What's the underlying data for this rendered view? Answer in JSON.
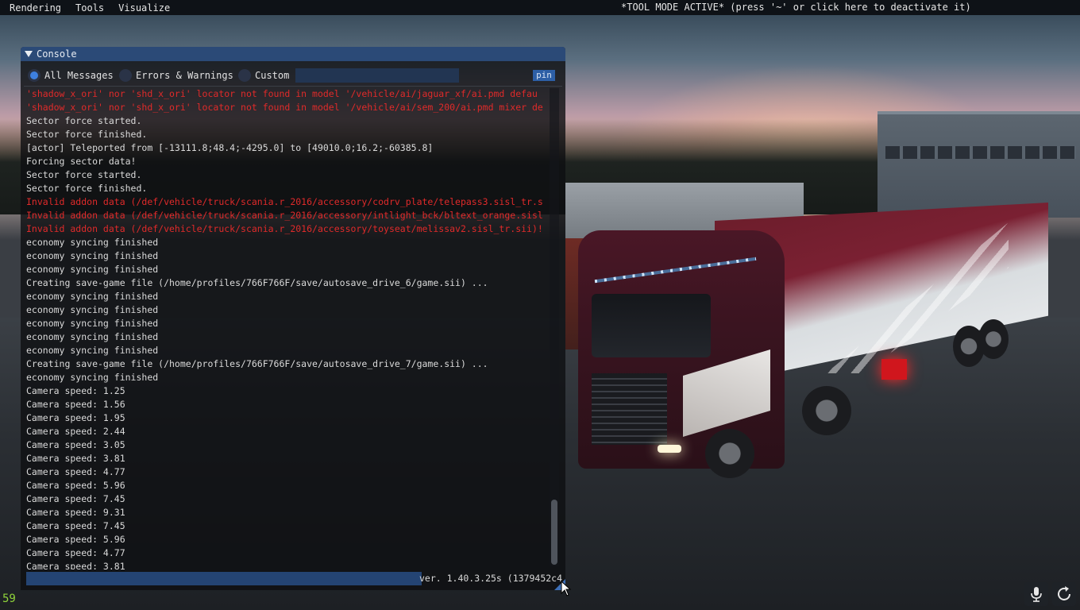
{
  "menubar": {
    "items": [
      "Rendering",
      "Tools",
      "Visualize"
    ],
    "tool_mode_notice": "*TOOL MODE ACTIVE* (press '~' or click here to deactivate it)"
  },
  "console": {
    "title": "Console",
    "filters": {
      "all_messages": "All Messages",
      "errors_warnings": "Errors & Warnings",
      "custom": "Custom",
      "selected": "All Messages",
      "custom_filter_value": ""
    },
    "pin_label": "pin",
    "log": [
      {
        "text": "'shadow_x_ori' nor 'shd_x_ori' locator not found in model '/vehicle/ai/jaguar_xf/ai.pmd defau",
        "type": "error"
      },
      {
        "text": "'shadow_x_ori' nor 'shd_x_ori' locator not found in model '/vehicle/ai/sem_200/ai.pmd mixer de",
        "type": "error"
      },
      {
        "text": "Sector force started.",
        "type": "info"
      },
      {
        "text": "Sector force finished.",
        "type": "info"
      },
      {
        "text": "[actor] Teleported from [-13111.8;48.4;-4295.0] to [49010.0;16.2;-60385.8]",
        "type": "info"
      },
      {
        "text": "Forcing sector data!",
        "type": "info"
      },
      {
        "text": "Sector force started.",
        "type": "info"
      },
      {
        "text": "Sector force finished.",
        "type": "info"
      },
      {
        "text": "Invalid addon data (/def/vehicle/truck/scania.r_2016/accessory/codrv_plate/telepass3.sisl_tr.s",
        "type": "error"
      },
      {
        "text": "Invalid addon data (/def/vehicle/truck/scania.r_2016/accessory/intlight_bck/bltext_orange.sisl",
        "type": "error"
      },
      {
        "text": "Invalid addon data (/def/vehicle/truck/scania.r_2016/accessory/toyseat/melissav2.sisl_tr.sii)!",
        "type": "error"
      },
      {
        "text": "economy syncing finished",
        "type": "info"
      },
      {
        "text": "economy syncing finished",
        "type": "info"
      },
      {
        "text": "economy syncing finished",
        "type": "info"
      },
      {
        "text": "Creating save-game file (/home/profiles/766F766F/save/autosave_drive_6/game.sii) ...",
        "type": "info"
      },
      {
        "text": "economy syncing finished",
        "type": "info"
      },
      {
        "text": "economy syncing finished",
        "type": "info"
      },
      {
        "text": "economy syncing finished",
        "type": "info"
      },
      {
        "text": "economy syncing finished",
        "type": "info"
      },
      {
        "text": "economy syncing finished",
        "type": "info"
      },
      {
        "text": "Creating save-game file (/home/profiles/766F766F/save/autosave_drive_7/game.sii) ...",
        "type": "info"
      },
      {
        "text": "economy syncing finished",
        "type": "info"
      },
      {
        "text": "Camera speed: 1.25",
        "type": "info"
      },
      {
        "text": "Camera speed: 1.56",
        "type": "info"
      },
      {
        "text": "Camera speed: 1.95",
        "type": "info"
      },
      {
        "text": "Camera speed: 2.44",
        "type": "info"
      },
      {
        "text": "Camera speed: 3.05",
        "type": "info"
      },
      {
        "text": "Camera speed: 3.81",
        "type": "info"
      },
      {
        "text": "Camera speed: 4.77",
        "type": "info"
      },
      {
        "text": "Camera speed: 5.96",
        "type": "info"
      },
      {
        "text": "Camera speed: 7.45",
        "type": "info"
      },
      {
        "text": "Camera speed: 9.31",
        "type": "info"
      },
      {
        "text": "Camera speed: 7.45",
        "type": "info"
      },
      {
        "text": "Camera speed: 5.96",
        "type": "info"
      },
      {
        "text": "Camera speed: 4.77",
        "type": "info"
      },
      {
        "text": "Camera speed: 3.81",
        "type": "info"
      }
    ],
    "command_value": "",
    "version": "ver. 1.40.3.25s (1379452c4"
  },
  "hud": {
    "fps": "59",
    "mic_icon": "microphone-icon",
    "refresh_icon": "refresh-icon"
  },
  "colors": {
    "title_bar": "#2b4a77",
    "error_text": "#e02a2a",
    "info_text": "#dadada",
    "accent": "#3d7fe0",
    "fps": "#8fd43a"
  }
}
